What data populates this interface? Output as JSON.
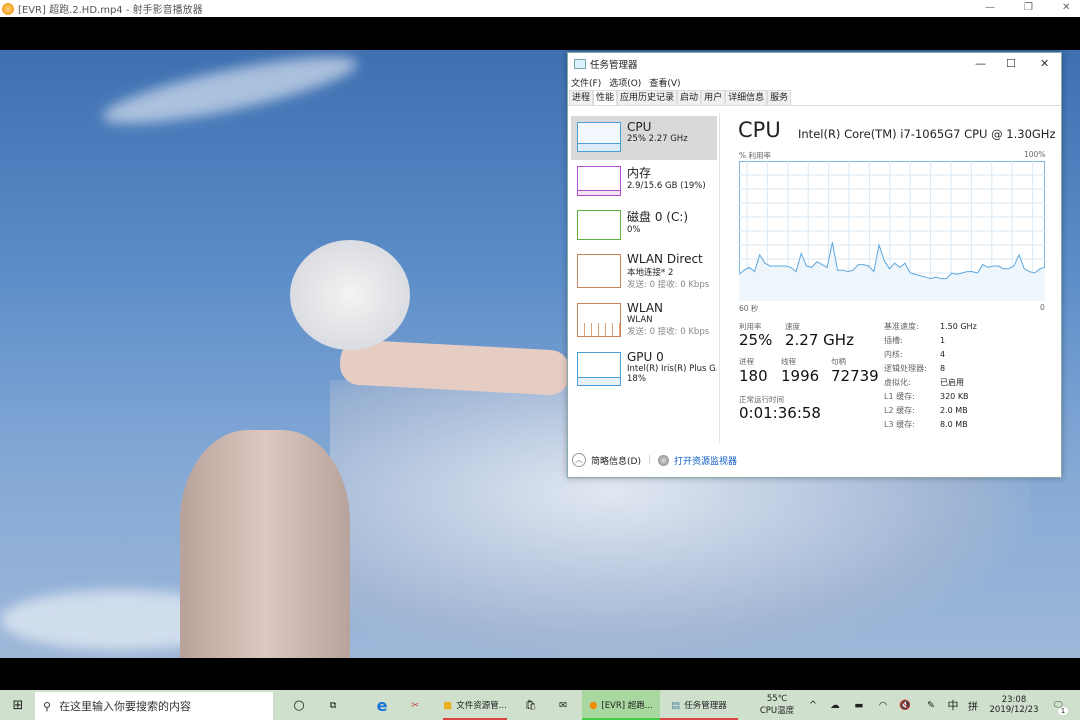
{
  "window_title": "[EVR] 超跑.2.HD.mp4 - 射手影音播放器",
  "task_manager": {
    "title": "任务管理器",
    "menu": [
      "文件(F)",
      "选项(O)",
      "查看(V)"
    ],
    "tabs": [
      "进程",
      "性能",
      "应用历史记录",
      "启动",
      "用户",
      "详细信息",
      "服务"
    ],
    "active_tab": "性能",
    "sidebar": [
      {
        "name": "CPU",
        "line1": "25% 2.27 GHz",
        "color": "#4a9fd8"
      },
      {
        "name": "内存",
        "line1": "2.9/15.6 GB (19%)",
        "color": "#b04cc8"
      },
      {
        "name": "磁盘 0 (C:)",
        "line1": "0%",
        "color": "#5cb23c"
      },
      {
        "name": "WLAN Direct",
        "line1": "本地连接* 2",
        "line2": "发送: 0 接收: 0 Kbps",
        "color": "#c8845a"
      },
      {
        "name": "WLAN",
        "line1": "WLAN",
        "line2": "发送: 0 接收: 0 Kbps",
        "color": "#c8845a"
      },
      {
        "name": "GPU 0",
        "line1": "Intel(R) Iris(R) Plus G...",
        "line2": "18%",
        "color": "#4a9fd8"
      }
    ],
    "cpu": {
      "heading": "CPU",
      "model": "Intel(R) Core(TM) i7-1065G7 CPU @ 1.30GHz",
      "y_label": "% 利用率",
      "y_max_label": "100%",
      "x_left_label": "60 秒",
      "x_right_label": "0",
      "utilization_label": "利用率",
      "utilization": "25%",
      "speed_label": "速度",
      "speed": "2.27 GHz",
      "processes_label": "进程",
      "processes": "180",
      "threads_label": "线程",
      "threads": "1996",
      "handles_label": "句柄",
      "handles": "72739",
      "uptime_label": "正常运行时间",
      "uptime": "0:01:36:58",
      "specs": [
        [
          "基准速度:",
          "1.50 GHz"
        ],
        [
          "插槽:",
          "1"
        ],
        [
          "内核:",
          "4"
        ],
        [
          "逻辑处理器:",
          "8"
        ],
        [
          "虚拟化:",
          "已启用"
        ],
        [
          "L1 缓存:",
          "320 KB"
        ],
        [
          "L2 缓存:",
          "2.0 MB"
        ],
        [
          "L3 缓存:",
          "8.0 MB"
        ]
      ]
    },
    "footer": {
      "summary": "简略信息(D)",
      "monitor": "打开资源监视器"
    }
  },
  "chart_data": {
    "type": "area",
    "title": "CPU",
    "ylabel": "% 利用率",
    "xlabel": "60 秒",
    "ylim": [
      0,
      100
    ],
    "xlim": [
      60,
      0
    ],
    "values": [
      19,
      22,
      24,
      21,
      33,
      27,
      25,
      25,
      25,
      25,
      24,
      21,
      34,
      25,
      24,
      28,
      26,
      24,
      42,
      22,
      22,
      21,
      22,
      26,
      26,
      25,
      21,
      40,
      29,
      23,
      27,
      24,
      27,
      20,
      19,
      18,
      17,
      16,
      17,
      16,
      16,
      20,
      19,
      20,
      21,
      21,
      20,
      26,
      24,
      25,
      25,
      23,
      23,
      25,
      33,
      23,
      21,
      20,
      23,
      24
    ]
  },
  "taskbar": {
    "search_placeholder": "在这里输入你要搜索的内容",
    "apps": [
      "文件资源管...",
      "[EVR] 超跑...",
      "任务管理器"
    ],
    "temp": "55℃",
    "temp_label": "CPU温度",
    "ime1": "中",
    "ime2": "拼",
    "time": "23:08",
    "date": "2019/12/23",
    "notif_count": "1"
  }
}
